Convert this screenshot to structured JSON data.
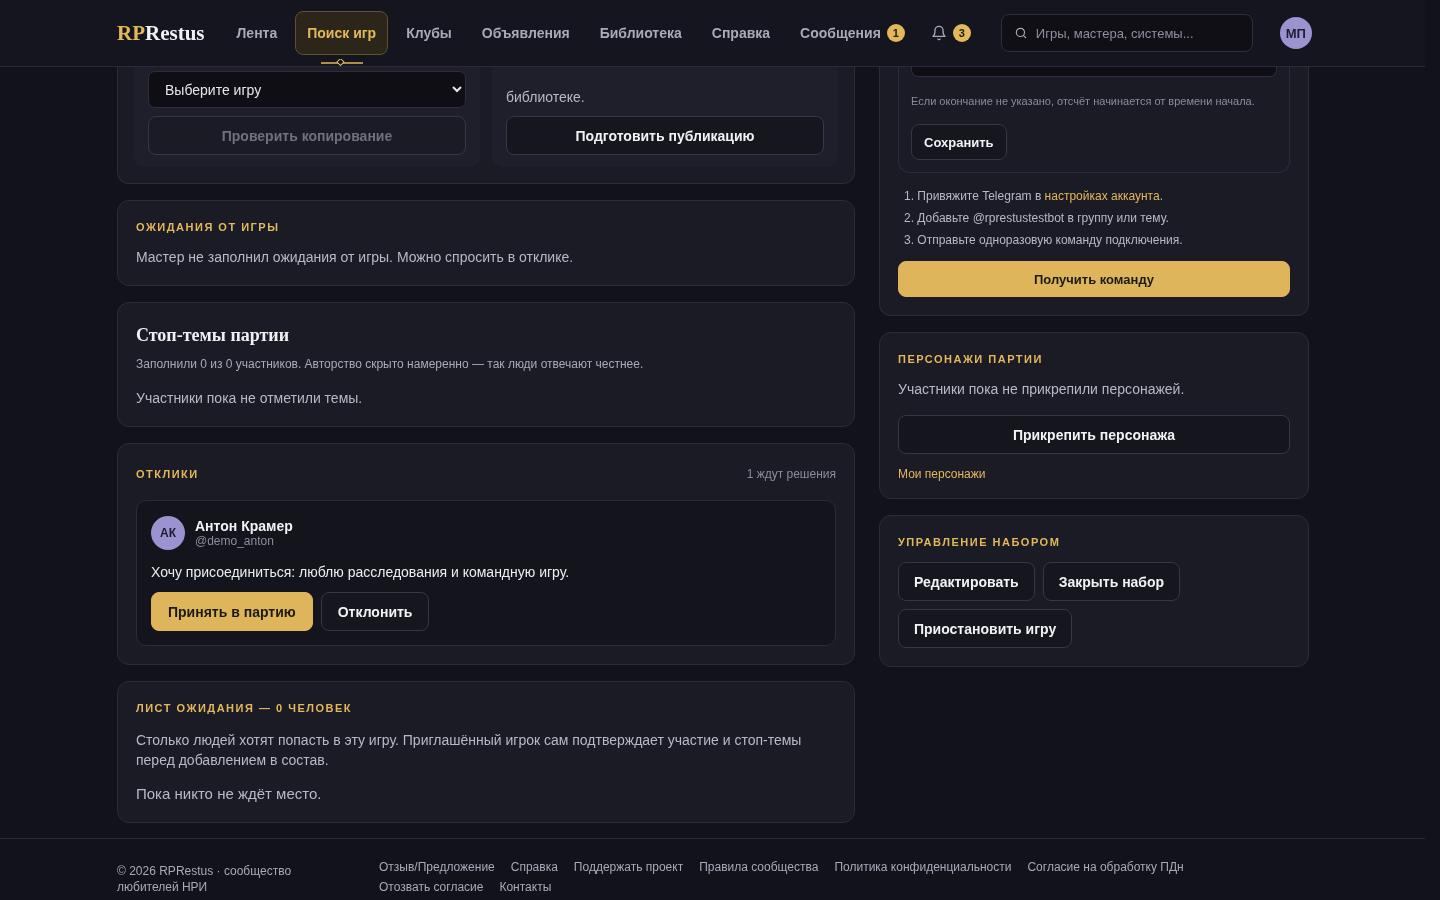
{
  "header": {
    "logo_accent": "RP",
    "logo_text": "Restus",
    "nav": [
      {
        "label": "Лента",
        "selected": false
      },
      {
        "label": "Поиск игр",
        "selected": true
      },
      {
        "label": "Клубы",
        "selected": false
      },
      {
        "label": "Объявления",
        "selected": false
      },
      {
        "label": "Библиотека",
        "selected": false
      },
      {
        "label": "Справка",
        "selected": false
      },
      {
        "label": "Сообщения",
        "selected": false,
        "badge": "1"
      }
    ],
    "notifications_badge": "3",
    "search": {
      "placeholder": "Игры, мастера, системы..."
    },
    "avatar": "МП"
  },
  "copy_panel": {
    "select_value": "Выберите игру",
    "check_button": {
      "label": "Проверить копирование",
      "disabled": true
    },
    "publish_text": "библиотеке.",
    "publish_button": "Подготовить публикацию"
  },
  "expectations": {
    "title": "ОЖИДАНИЯ ОТ ИГРЫ",
    "text": "Мастер не заполнил ожидания от игры. Можно спросить в отклике."
  },
  "stop_topics": {
    "title": "Стоп-темы партии",
    "note": "Заполнили 0 из 0 участников. Авторство скрыто намеренно — так люди отвечают честнее.",
    "text": "Участники пока не отметили темы."
  },
  "responses": {
    "title": "ОТКЛИКИ",
    "count": "1 ждут решения",
    "items": [
      {
        "initials": "АК",
        "name": "Антон Крамер",
        "handle": "@demo_anton",
        "message": "Хочу присоединиться: люблю расследования и командную игру.",
        "accept": "Принять в партию",
        "decline": "Отклонить"
      }
    ]
  },
  "waitlist": {
    "title": "ЛИСТ ОЖИДАНИЯ — 0 ЧЕЛОВЕК",
    "text": "Столько людей хотят попасть в эту игру. Приглашённый игрок сам подтверждает участие и стоп-темы перед добавлением в состав.",
    "empty": "Пока никто не ждёт место."
  },
  "telegram": {
    "hint": "Если окончание не указано, отсчёт начинается от времени начала.",
    "save": "Сохранить",
    "steps": [
      {
        "number": "1.",
        "text": "Привяжите Telegram в ",
        "link": "настройках аккаунта",
        "after": "."
      },
      {
        "number": "2.",
        "text": "Добавьте @rprestustestbot в группу или тему."
      },
      {
        "number": "3.",
        "text": "Отправьте одноразовую команду подключения."
      }
    ],
    "button": "Получить команду"
  },
  "characters": {
    "title": "ПЕРСОНАЖИ ПАРТИИ",
    "text": "Участники пока не прикрепили персонажей.",
    "button": "Прикрепить персонажа",
    "link": "Мои персонажи"
  },
  "recruitment": {
    "title": "УПРАВЛЕНИЕ НАБОРОМ",
    "buttons": [
      "Редактировать",
      "Закрыть набор",
      "Приостановить игру"
    ]
  },
  "footer": {
    "copyright": "© 2026 RPRestus · сообщество любителей НРИ",
    "links": [
      "Отзыв/Предложение",
      "Справка",
      "Поддержать проект",
      "Правила сообщества",
      "Политика конфиденциальности",
      "Согласие на обработку ПДн",
      "Отозвать согласие",
      "Контакты"
    ]
  }
}
